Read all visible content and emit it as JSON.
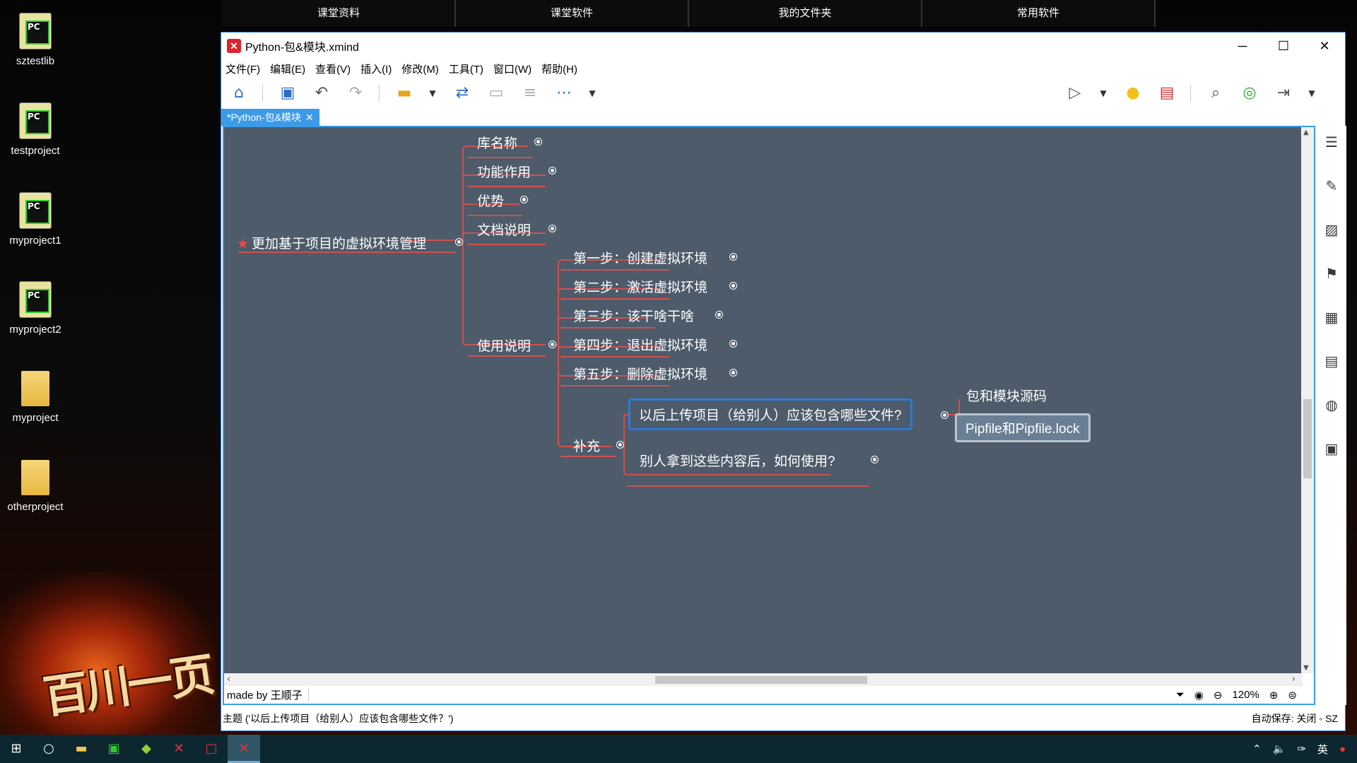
{
  "desktop": {
    "icons": [
      {
        "label": "sztestlib",
        "type": "pycharm"
      },
      {
        "label": "testproject",
        "type": "pycharm"
      },
      {
        "label": "myproject1",
        "type": "pycharm"
      },
      {
        "label": "myproject2",
        "type": "pycharm"
      },
      {
        "label": "myproject",
        "type": "folder"
      },
      {
        "label": "otherproject",
        "type": "folder"
      }
    ],
    "wallpaper_text": "百川一页"
  },
  "top_tabs": [
    "课堂资料",
    "课堂软件",
    "我的文件夹",
    "常用软件"
  ],
  "window": {
    "title": "Python-包&模块.xmind",
    "controls": {
      "minimize": "─",
      "maximize": "☐",
      "close": "✕"
    }
  },
  "menu": [
    "文件(F)",
    "编辑(E)",
    "查看(V)",
    "插入(I)",
    "修改(M)",
    "工具(T)",
    "窗口(W)",
    "帮助(H)"
  ],
  "doc_tab": {
    "label": "*Python-包&模块",
    "close": "✕"
  },
  "mindmap": {
    "main": "更加基于项目的虚拟环境管理",
    "branches": [
      "库名称",
      "功能作用",
      "优势",
      "文档说明",
      "使用说明"
    ],
    "usage_steps": [
      "第一步：创建虚拟环境",
      "第二步：激活虚拟环境",
      "第三步：该干啥干啥",
      "第四步：退出虚拟环境",
      "第五步：删除虚拟环境",
      "补充"
    ],
    "supplement": [
      "以后上传项目（给别人）应该包含哪些文件?",
      "别人拿到这些内容后，如何使用?"
    ],
    "answers": [
      "包和模块源码",
      "Pipfile和Pipfile.lock"
    ]
  },
  "footer": {
    "author": "made by 王顺子",
    "zoom": "120%"
  },
  "status": {
    "left": "主题 ('以后上传项目（给别人）应该包含哪些文件？')",
    "right": "自动保存: 关闭  ◦ SZ"
  },
  "taskbar": {
    "tray_lang": "英"
  }
}
